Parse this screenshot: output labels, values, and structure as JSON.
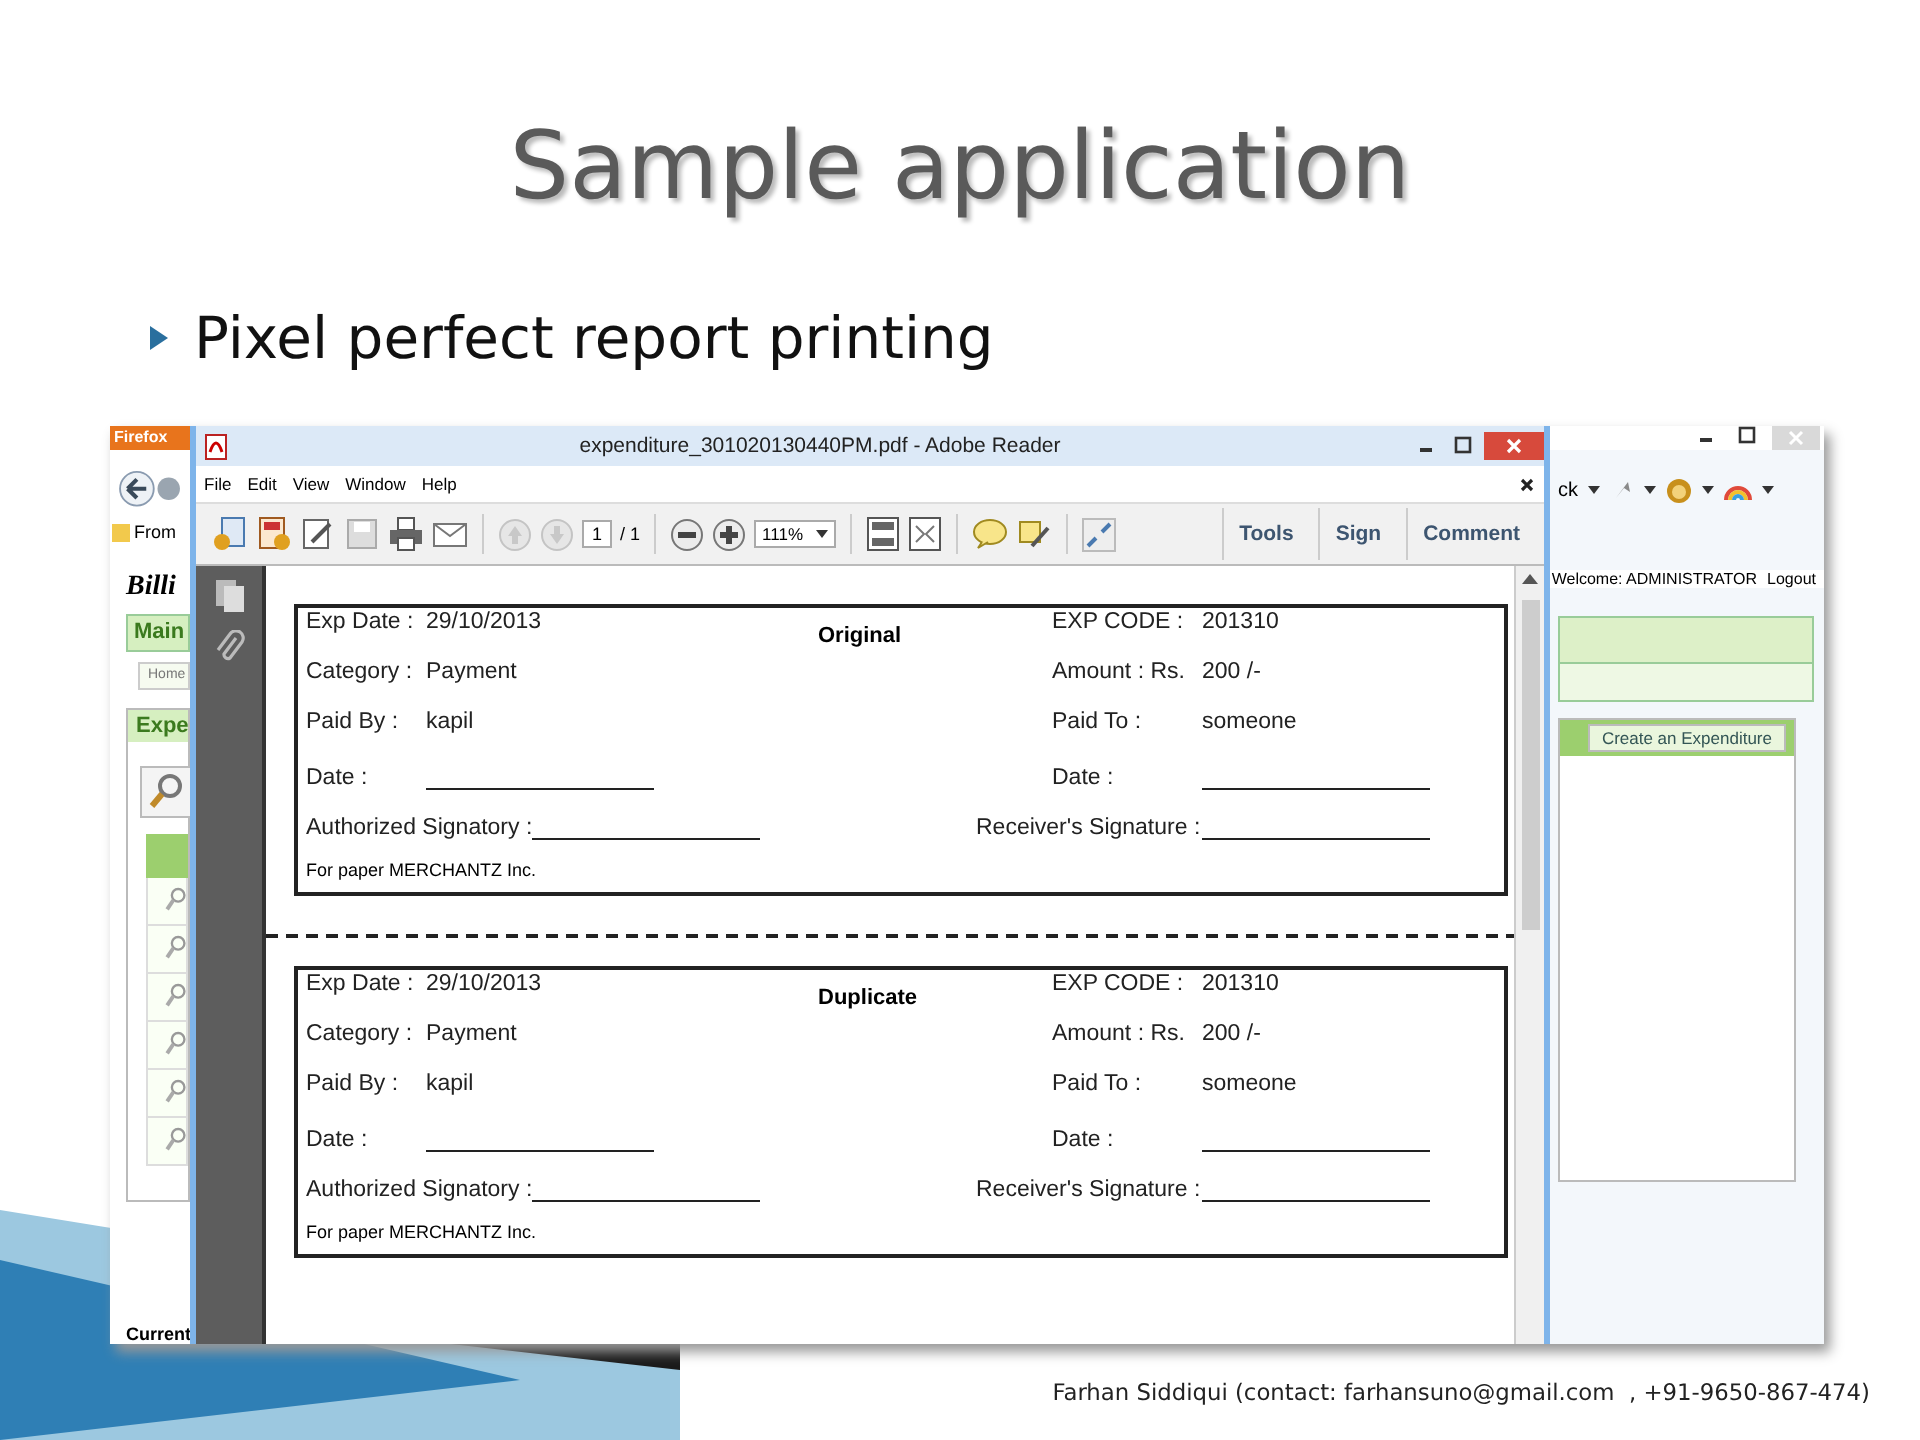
{
  "slide": {
    "title": "Sample application",
    "bullet": "Pixel perfect report printing",
    "footer": "Farhan Siddiqui (contact: farhansuno@gmail.com  , +91-9650-867-474)"
  },
  "browser": {
    "app_button": "Firefox",
    "bookmark": "From",
    "toolbar_fragment": "ck",
    "logo": "Billi",
    "main_tab": "Main",
    "home_tab": "Home",
    "panel_header": "Expe",
    "welcome": "Welcome: ADMINISTRATOR",
    "logout": "Logout",
    "create_button": "Create an Expenditure",
    "status": "Current"
  },
  "reader": {
    "title": "expenditure_301020130440PM.pdf - Adobe Reader",
    "menu": [
      "File",
      "Edit",
      "View",
      "Window",
      "Help"
    ],
    "page_field": "1",
    "page_total": "/ 1",
    "zoom": "111%",
    "tool_tabs": [
      "Tools",
      "Sign",
      "Comment"
    ],
    "receipts": [
      {
        "heading": "Original",
        "footer": "For paper MERCHANTZ Inc.",
        "rows": [
          {
            "kind": "field",
            "left": {
              "label": "Exp Date :",
              "value": "29/10/2013"
            },
            "right": {
              "label": "EXP CODE :",
              "value": "201310"
            }
          },
          {
            "kind": "field",
            "left": {
              "label": "Category :",
              "value": "Payment"
            },
            "right": {
              "label": "Amount : Rs.",
              "value": "200 /-"
            }
          },
          {
            "kind": "field",
            "left": {
              "label": "Paid By :",
              "value": "kapil"
            },
            "right": {
              "label": "Paid To :",
              "value": "someone"
            }
          },
          {
            "kind": "blank",
            "left": {
              "label": "Date :"
            },
            "right": {
              "label": "Date :"
            }
          },
          {
            "kind": "signature",
            "left": {
              "label": "Authorized Signatory :"
            },
            "right": {
              "label": "Receiver's Signature :"
            }
          }
        ]
      },
      {
        "heading": "Duplicate",
        "footer": "For paper MERCHANTZ Inc.",
        "rows": [
          {
            "kind": "field",
            "left": {
              "label": "Exp Date :",
              "value": "29/10/2013"
            },
            "right": {
              "label": "EXP CODE :",
              "value": "201310"
            }
          },
          {
            "kind": "field",
            "left": {
              "label": "Category :",
              "value": "Payment"
            },
            "right": {
              "label": "Amount : Rs.",
              "value": "200 /-"
            }
          },
          {
            "kind": "field",
            "left": {
              "label": "Paid By :",
              "value": "kapil"
            },
            "right": {
              "label": "Paid To :",
              "value": "someone"
            }
          },
          {
            "kind": "blank",
            "left": {
              "label": "Date :"
            },
            "right": {
              "label": "Date :"
            }
          },
          {
            "kind": "signature",
            "left": {
              "label": "Authorized Signatory :"
            },
            "right": {
              "label": "Receiver's Signature :"
            }
          }
        ]
      }
    ]
  }
}
